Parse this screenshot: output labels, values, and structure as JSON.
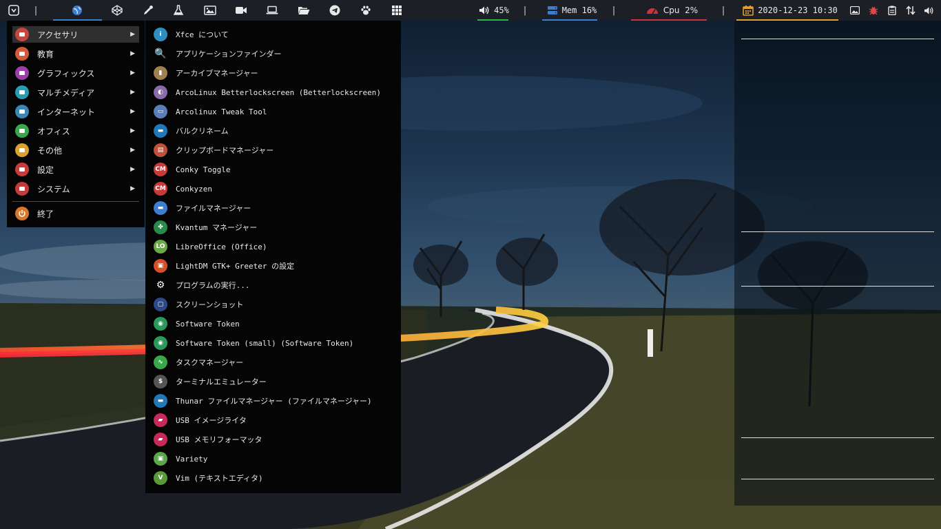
{
  "panel": {
    "separator": "|",
    "launchers": [
      "whisker-menu-icon",
      "globe-icon",
      "codepen-icon",
      "eyedropper-icon",
      "flask-icon",
      "image-icon",
      "video-camera-icon",
      "laptop-icon",
      "folder-open-icon",
      "telegram-icon",
      "paw-icon",
      "grid-icon"
    ],
    "volume": {
      "label": "45%",
      "color": "#2fb544"
    },
    "memory": {
      "label": "Mem 16%",
      "color": "#3a7fd0"
    },
    "cpu": {
      "label": "Cpu  2%",
      "color": "#d0323a"
    },
    "clock": {
      "label": "2020-12-23 10:30",
      "color": "#e0a030"
    },
    "tray": [
      "photo-tray-icon",
      "bug-tray-icon",
      "clipboard-tray-icon",
      "network-tray-icon",
      "speaker-tray-icon"
    ]
  },
  "menu": {
    "categories": [
      {
        "label": "アクセサリ",
        "arrow": "▶",
        "color": "#c9453f",
        "icon": "accessories-icon"
      },
      {
        "label": "教育",
        "arrow": "▶",
        "color": "#d4583a",
        "icon": "education-icon"
      },
      {
        "label": "グラフィックス",
        "arrow": "▶",
        "color": "#9b3fa8",
        "icon": "graphics-icon"
      },
      {
        "label": "マルチメディア",
        "arrow": "▶",
        "color": "#2a9bb3",
        "icon": "multimedia-icon"
      },
      {
        "label": "インターネット",
        "arrow": "▶",
        "color": "#3a86b5",
        "icon": "internet-icon"
      },
      {
        "label": "オフィス",
        "arrow": "▶",
        "color": "#3aa84a",
        "icon": "office-icon"
      },
      {
        "label": "その他",
        "arrow": "▶",
        "color": "#d8a22c",
        "icon": "other-icon"
      },
      {
        "label": "設定",
        "arrow": "▶",
        "color": "#c93a3a",
        "icon": "settings-icon"
      },
      {
        "label": "システム",
        "arrow": "▶",
        "color": "#c83a3a",
        "icon": "system-icon"
      }
    ],
    "quit_label": "終了",
    "items": [
      {
        "label": "Xfce について",
        "color": "#2c8fc0",
        "glyph": "i",
        "icon": "xfce-about-icon"
      },
      {
        "label": "アプリケーションファインダー",
        "color": "#050505",
        "glyph": "🔍",
        "icon": "app-finder-icon"
      },
      {
        "label": "アーカイブマネージャー",
        "color": "#a08050",
        "glyph": "▮",
        "icon": "archive-manager-icon"
      },
      {
        "label": "ArcoLinux Betterlockscreen (Betterlockscreen)",
        "color": "#8a6aa8",
        "glyph": "◐",
        "icon": "betterlockscreen-icon"
      },
      {
        "label": "Arcolinux Tweak Tool",
        "color": "#5a7fb8",
        "glyph": "▭",
        "icon": "tweak-tool-icon"
      },
      {
        "label": "バルクリネーム",
        "color": "#1f78b8",
        "glyph": "▬",
        "icon": "bulk-rename-icon"
      },
      {
        "label": "クリップボードマネージャー",
        "color": "#c0503a",
        "glyph": "▤",
        "icon": "clipboard-manager-icon"
      },
      {
        "label": "Conky Toggle",
        "color": "#c83a3a",
        "glyph": "CM",
        "icon": "conky-toggle-icon"
      },
      {
        "label": "Conkyzen",
        "color": "#c83a3a",
        "glyph": "CM",
        "icon": "conkyzen-icon"
      },
      {
        "label": "ファイルマネージャー",
        "color": "#3a7fd0",
        "glyph": "▬",
        "icon": "file-manager-icon"
      },
      {
        "label": "Kvantum マネージャー",
        "color": "#2a8a4a",
        "glyph": "✤",
        "icon": "kvantum-icon"
      },
      {
        "label": "LibreOffice (Office)",
        "color": "#6aa84a",
        "glyph": "LO",
        "icon": "libreoffice-icon"
      },
      {
        "label": "LightDM GTK+ Greeter の設定",
        "color": "#d8502a",
        "glyph": "▣",
        "icon": "lightdm-greeter-icon"
      },
      {
        "label": "プログラムの実行...",
        "color": "#050505",
        "glyph": "⚙",
        "icon": "run-program-icon"
      },
      {
        "label": "スクリーンショット",
        "color": "#2c4a8a",
        "glyph": "▢",
        "icon": "screenshot-icon"
      },
      {
        "label": "Software Token",
        "color": "#2a9a5a",
        "glyph": "◉",
        "icon": "software-token-icon"
      },
      {
        "label": "Software Token (small) (Software Token)",
        "color": "#2a9a5a",
        "glyph": "◉",
        "icon": "software-token-small-icon"
      },
      {
        "label": "タスクマネージャー",
        "color": "#3aa84a",
        "glyph": "∿",
        "icon": "task-manager-icon"
      },
      {
        "label": "ターミナルエミュレーター",
        "color": "#555555",
        "glyph": "$",
        "icon": "terminal-icon"
      },
      {
        "label": "Thunar ファイルマネージャー (ファイルマネージャー)",
        "color": "#1f78b8",
        "glyph": "▬",
        "icon": "thunar-icon"
      },
      {
        "label": "USB イメージライタ",
        "color": "#c8285a",
        "glyph": "▰",
        "icon": "usb-image-writer-icon"
      },
      {
        "label": "USB メモリフォーマッタ",
        "color": "#c8285a",
        "glyph": "▰",
        "icon": "usb-formatter-icon"
      },
      {
        "label": "Variety",
        "color": "#5aa84a",
        "glyph": "▣",
        "icon": "variety-icon"
      },
      {
        "label": "Vim (テキストエディタ)",
        "color": "#5a9a3a",
        "glyph": "V",
        "icon": "vim-icon"
      }
    ]
  }
}
